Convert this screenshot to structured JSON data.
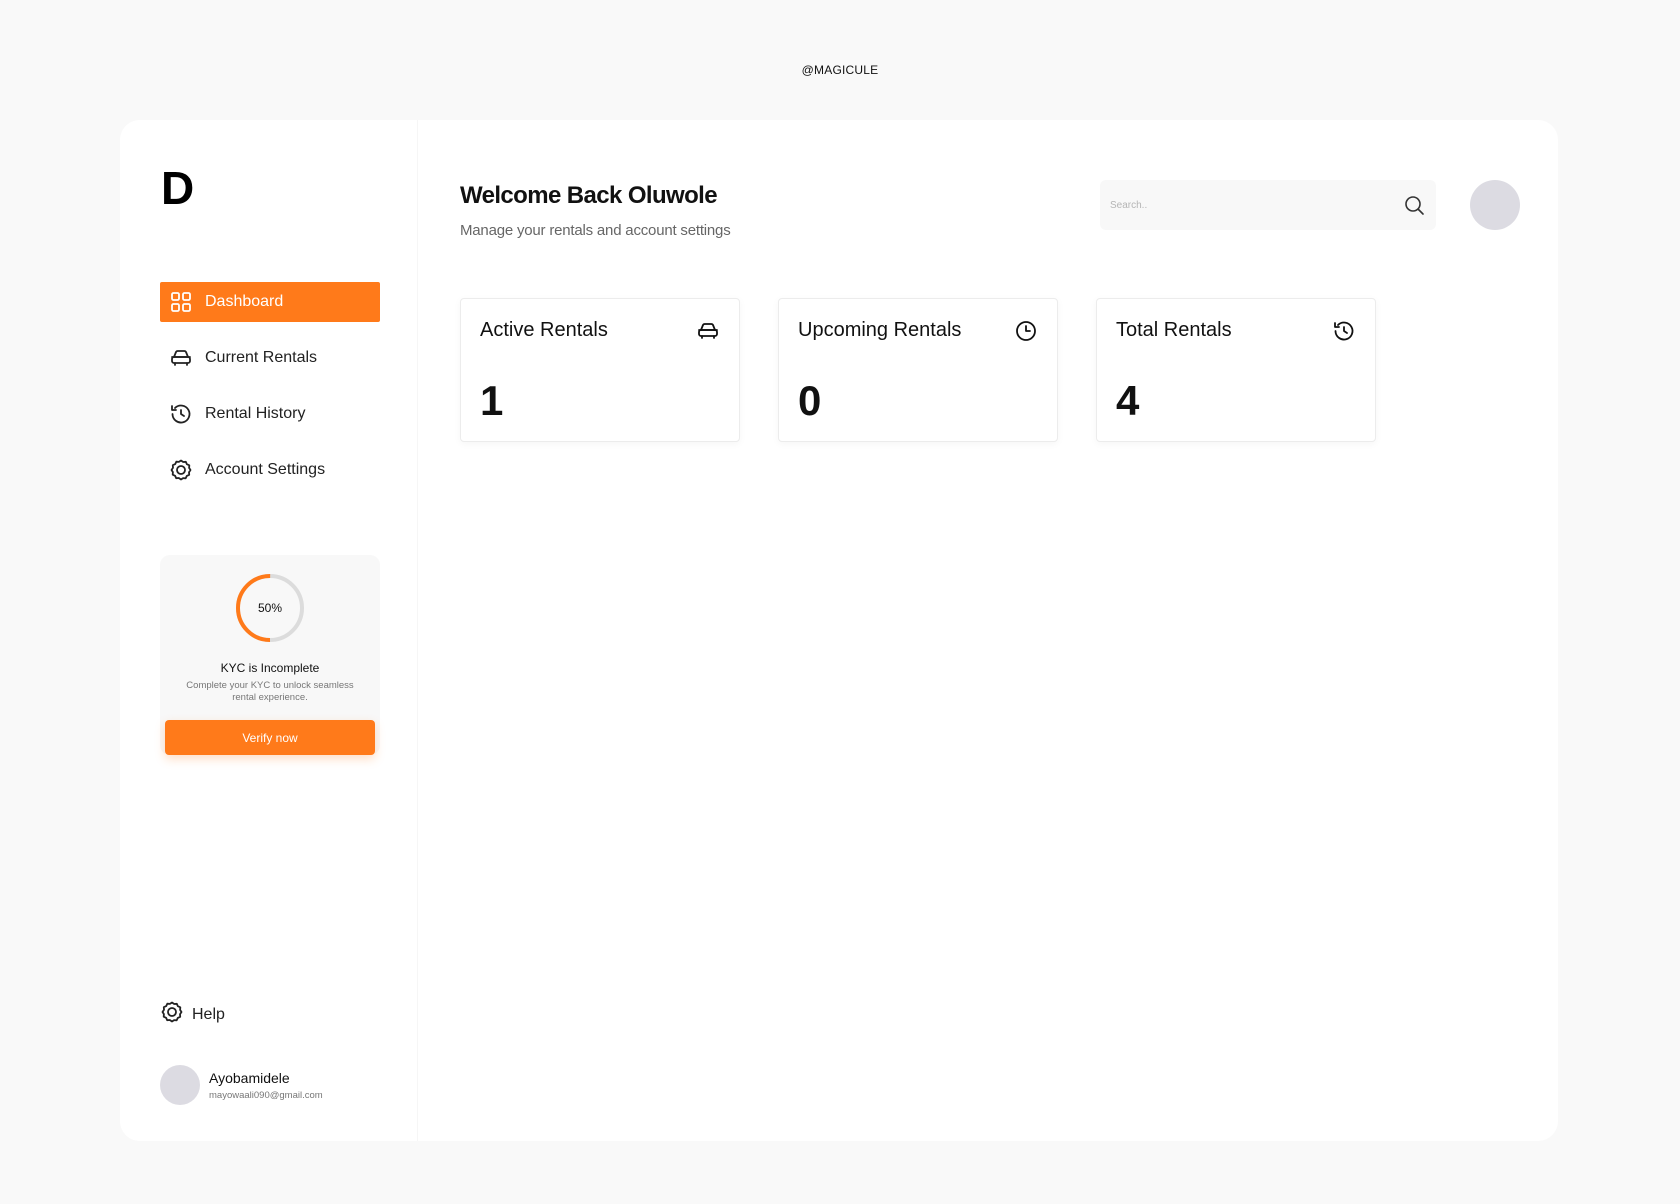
{
  "watermark": "@MAGICULE",
  "brand": {
    "logo": "D",
    "accent_color": "#ff7a1a"
  },
  "sidebar": {
    "items": [
      {
        "label": "Dashboard",
        "icon": "grid-icon",
        "active": true
      },
      {
        "label": "Current Rentals",
        "icon": "car-icon",
        "active": false
      },
      {
        "label": "Rental History",
        "icon": "history-icon",
        "active": false
      },
      {
        "label": "Account Settings",
        "icon": "gear-icon",
        "active": false
      }
    ],
    "kyc": {
      "progress_label": "50%",
      "progress": 0.5,
      "title": "KYC is Incomplete",
      "description": "Complete your KYC to unlock seamless rental experience.",
      "button_label": "Verify now"
    },
    "help_label": "Help",
    "user": {
      "name": "Ayobamidele",
      "email": "mayowaali090@gmail.com"
    }
  },
  "header": {
    "title": "Welcome Back Oluwole",
    "subtitle": "Manage your rentals and account settings",
    "search_placeholder": "Search.."
  },
  "stats": [
    {
      "title": "Active Rentals",
      "value": "1",
      "icon": "car-icon"
    },
    {
      "title": "Upcoming Rentals",
      "value": "0",
      "icon": "clock-icon"
    },
    {
      "title": "Total Rentals",
      "value": "4",
      "icon": "history-icon"
    }
  ]
}
